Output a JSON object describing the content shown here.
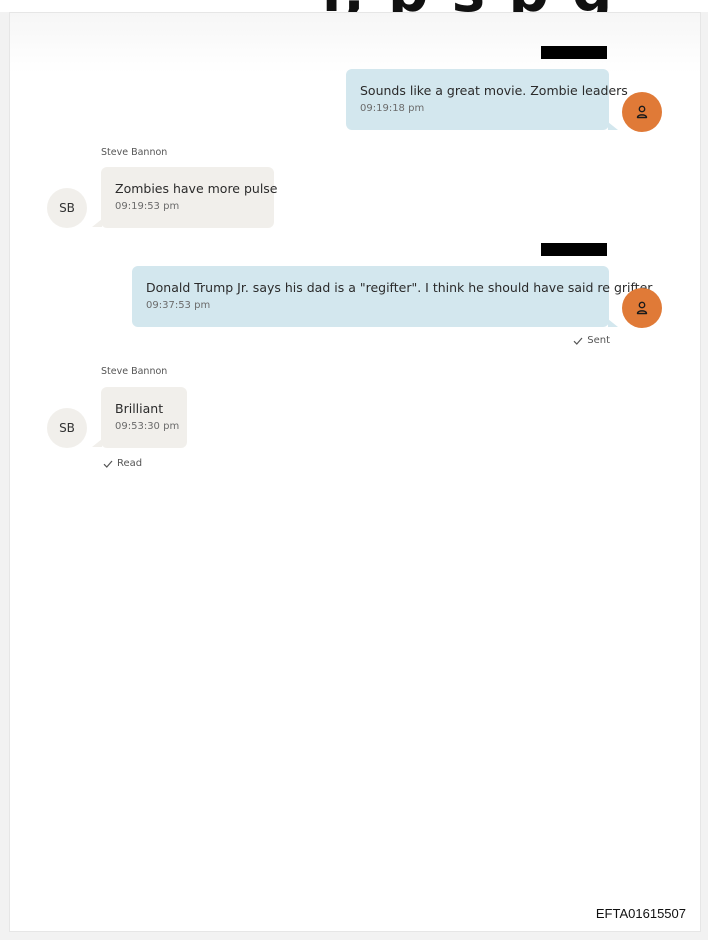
{
  "header": {
    "cut_off_text": "r, p s p g"
  },
  "messages": [
    {
      "direction": "outgoing",
      "text": "Sounds like a great movie. Zombie leaders",
      "time": "09:19:18 pm"
    },
    {
      "direction": "incoming",
      "sender": "Steve Bannon",
      "avatar_initials": "SB",
      "text": "Zombies have more pulse",
      "time": "09:19:53 pm"
    },
    {
      "direction": "outgoing",
      "text": "Donald Trump Jr. says his dad is a \"regifter\".   I think he should have said re grifter",
      "time": "09:37:53 pm",
      "status": "Sent"
    },
    {
      "direction": "incoming",
      "sender": "Steve Bannon",
      "avatar_initials": "SB",
      "text": "Brilliant",
      "time": "09:53:30 pm",
      "status": "Read"
    }
  ],
  "footer": {
    "document_id": "EFTA01615507"
  },
  "colors": {
    "outgoing_bubble": "#d3e7ee",
    "incoming_bubble": "#f1efeb",
    "my_avatar": "#e07a37",
    "redaction": "#000000"
  },
  "icons": {
    "my_avatar": "person-icon",
    "status": "check-icon"
  }
}
